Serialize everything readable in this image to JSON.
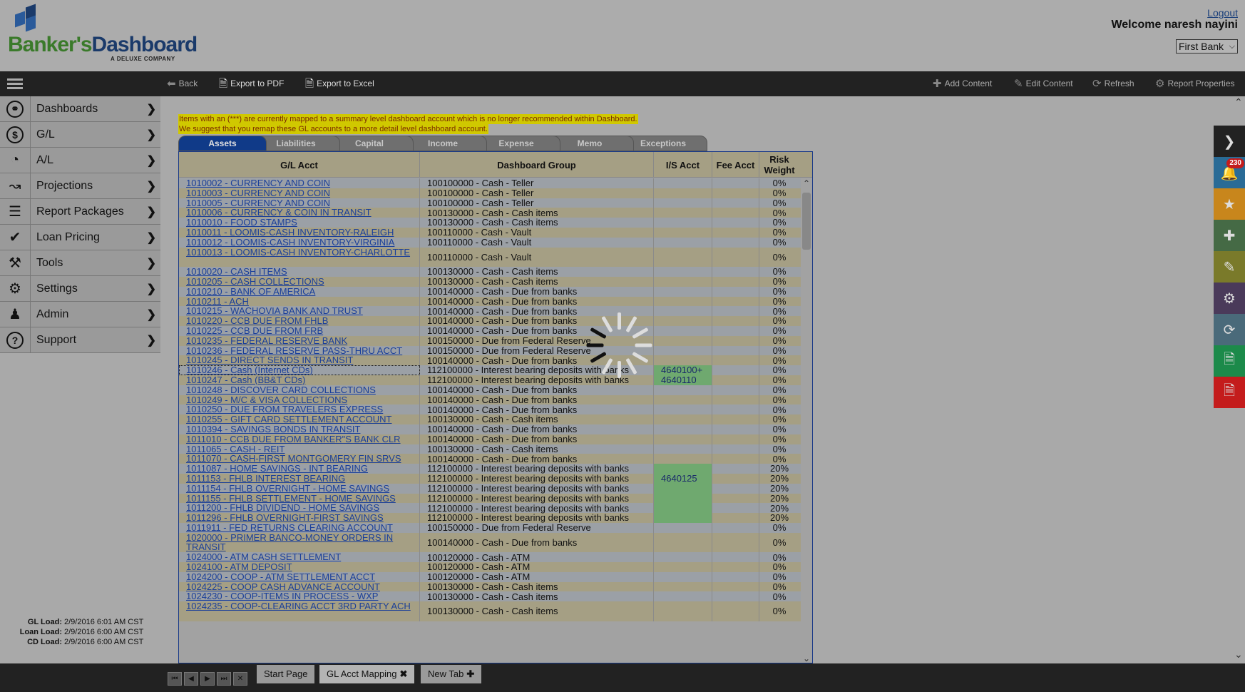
{
  "header": {
    "brand_part1": "Banker's",
    "brand_part2": "Dashboard",
    "brand_tagline": "A DELUXE COMPANY",
    "logout": "Logout",
    "welcome": "Welcome  naresh nayini",
    "bank": "First Bank"
  },
  "toolbar": {
    "back": "Back",
    "export_pdf": "Export to PDF",
    "export_excel": "Export to Excel",
    "add_content": "Add Content",
    "edit_content": "Edit Content",
    "refresh": "Refresh",
    "report_properties": "Report Properties"
  },
  "sidebar": {
    "items": [
      {
        "label": "Dashboards",
        "icon": "dashboard-icon"
      },
      {
        "label": "G/L",
        "icon": "dollar-icon"
      },
      {
        "label": "A/L",
        "icon": "pie-chart-icon"
      },
      {
        "label": "Projections",
        "icon": "line-chart-icon"
      },
      {
        "label": "Report Packages",
        "icon": "layers-icon"
      },
      {
        "label": "Loan Pricing",
        "icon": "check-icon"
      },
      {
        "label": "Tools",
        "icon": "hammer-icon"
      },
      {
        "label": "Settings",
        "icon": "gear-icon"
      },
      {
        "label": "Admin",
        "icon": "user-icon"
      },
      {
        "label": "Support",
        "icon": "help-icon"
      }
    ]
  },
  "loads": [
    {
      "label": "GL Load:",
      "value": "2/9/2016 6:01 AM CST"
    },
    {
      "label": "Loan Load:",
      "value": "2/9/2016 6:00 AM CST"
    },
    {
      "label": "CD Load:",
      "value": "2/9/2016 6:00 AM CST"
    }
  ],
  "notice": {
    "line1": "Items with an (***) are currently mapped to a summary level dashboard account which is no longer recommended within Dashboard.",
    "line2": "We suggest that you remap these GL accounts to a more detail level dashboard account."
  },
  "tabs": [
    "Assets",
    "Liabilities",
    "Capital",
    "Income",
    "Expense",
    "Memo",
    "Exceptions"
  ],
  "active_tab": "Assets",
  "columns": [
    "G/L Acct",
    "Dashboard Group",
    "I/S Acct",
    "Fee Acct",
    "Risk Weight"
  ],
  "rows": [
    {
      "gl": "1010002 - CURRENCY AND COIN",
      "group": "100100000 - Cash - Teller",
      "is": "",
      "fee": "",
      "risk": "0%"
    },
    {
      "gl": "1010003 - CURRENCY AND COIN",
      "group": "100100000 - Cash - Teller",
      "is": "",
      "fee": "",
      "risk": "0%"
    },
    {
      "gl": "1010005 - CURRENCY AND COIN",
      "group": "100100000 - Cash - Teller",
      "is": "",
      "fee": "",
      "risk": "0%"
    },
    {
      "gl": "1010006 - CURRENCY & COIN IN TRANSIT",
      "group": "100130000 - Cash - Cash items",
      "is": "",
      "fee": "",
      "risk": "0%"
    },
    {
      "gl": "1010010 - FOOD STAMPS",
      "group": "100130000 - Cash - Cash items",
      "is": "",
      "fee": "",
      "risk": "0%"
    },
    {
      "gl": "1010011 - LOOMIS-CASH INVENTORY-RALEIGH",
      "group": "100110000 - Cash - Vault",
      "is": "",
      "fee": "",
      "risk": "0%"
    },
    {
      "gl": "1010012 - LOOMIS-CASH INVENTORY-VIRGINIA",
      "group": "100110000 - Cash - Vault",
      "is": "",
      "fee": "",
      "risk": "0%"
    },
    {
      "gl": "1010013 - LOOMIS-CASH INVENTORY-CHARLOTTE",
      "group": "100110000 - Cash - Vault",
      "is": "",
      "fee": "",
      "risk": "0%",
      "tall": true
    },
    {
      "gl": "1010020 - CASH ITEMS",
      "group": "100130000 - Cash - Cash items",
      "is": "",
      "fee": "",
      "risk": "0%"
    },
    {
      "gl": "1010205 - CASH COLLECTIONS",
      "group": "100130000 - Cash - Cash items",
      "is": "",
      "fee": "",
      "risk": "0%"
    },
    {
      "gl": "1010210 - BANK OF AMERICA",
      "group": "100140000 - Cash - Due from banks",
      "is": "",
      "fee": "",
      "risk": "0%"
    },
    {
      "gl": "1010211 - ACH",
      "group": "100140000 - Cash - Due from banks",
      "is": "",
      "fee": "",
      "risk": "0%"
    },
    {
      "gl": "1010215 - WACHOVIA BANK AND TRUST",
      "group": "100140000 - Cash - Due from banks",
      "is": "",
      "fee": "",
      "risk": "0%"
    },
    {
      "gl": "1010220 - CCB DUE FROM FHLB",
      "group": "100140000 - Cash - Due from banks",
      "is": "",
      "fee": "",
      "risk": "0%"
    },
    {
      "gl": "1010225 - CCB DUE FROM FRB",
      "group": "100140000 - Cash - Due from banks",
      "is": "",
      "fee": "",
      "risk": "0%"
    },
    {
      "gl": "1010235 - FEDERAL RESERVE BANK",
      "group": "100150000 - Due from Federal Reserve",
      "is": "",
      "fee": "",
      "risk": "0%"
    },
    {
      "gl": "1010236 - FEDERAL RESERVE PASS-THRU ACCT",
      "group": "100150000 - Due from Federal Reserve",
      "is": "",
      "fee": "",
      "risk": "0%"
    },
    {
      "gl": "1010245 - DIRECT SENDS IN TRANSIT",
      "group": "100140000 - Cash - Due from banks",
      "is": "",
      "fee": "",
      "risk": "0%"
    },
    {
      "gl": "1010246 - Cash (Internet CDs)",
      "group": "112100000 - Interest bearing deposits with banks",
      "is": "4640100+",
      "fee": "",
      "risk": "0%",
      "green": true,
      "focused": true
    },
    {
      "gl": "1010247 - Cash (BB&T CDs)",
      "group": "112100000 - Interest bearing deposits with banks",
      "is": "4640110",
      "fee": "",
      "risk": "0%",
      "green": true
    },
    {
      "gl": "1010248 - DISCOVER CARD COLLECTIONS",
      "group": "100140000 - Cash - Due from banks",
      "is": "",
      "fee": "",
      "risk": "0%"
    },
    {
      "gl": "1010249 - M/C & VISA COLLECTIONS",
      "group": "100140000 - Cash - Due from banks",
      "is": "",
      "fee": "",
      "risk": "0%"
    },
    {
      "gl": "1010250 - DUE FROM TRAVELERS EXPRESS",
      "group": "100140000 - Cash - Due from banks",
      "is": "",
      "fee": "",
      "risk": "0%"
    },
    {
      "gl": "1010255 - GIFT CARD SETTLEMENT ACCOUNT",
      "group": "100130000 - Cash - Cash items",
      "is": "",
      "fee": "",
      "risk": "0%"
    },
    {
      "gl": "1010394 - SAVINGS BONDS IN TRANSIT",
      "group": "100140000 - Cash - Due from banks",
      "is": "",
      "fee": "",
      "risk": "0%"
    },
    {
      "gl": "1011010 - CCB DUE FROM BANKER\"S BANK CLR",
      "group": "100140000 - Cash - Due from banks",
      "is": "",
      "fee": "",
      "risk": "0%"
    },
    {
      "gl": "1011065 - CASH - REIT",
      "group": "100130000 - Cash - Cash items",
      "is": "",
      "fee": "",
      "risk": "0%"
    },
    {
      "gl": "1011070 - CASH-FIRST MONTGOMERY FIN SRVS",
      "group": "100140000 - Cash - Due from banks",
      "is": "",
      "fee": "",
      "risk": "0%"
    },
    {
      "gl": "1011087 - HOME SAVINGS - INT BEARING",
      "group": "112100000 - Interest bearing deposits with banks",
      "is": "",
      "fee": "",
      "risk": "20%",
      "green": true
    },
    {
      "gl": "1011153 - FHLB INTEREST BEARING",
      "group": "112100000 - Interest bearing deposits with banks",
      "is": "4640125",
      "fee": "",
      "risk": "20%",
      "green": true
    },
    {
      "gl": "1011154 - FHLB OVERNIGHT - HOME SAVINGS",
      "group": "112100000 - Interest bearing deposits with banks",
      "is": "",
      "fee": "",
      "risk": "20%",
      "green": true
    },
    {
      "gl": "1011155 - FHLB SETTLEMENT - HOME SAVINGS",
      "group": "112100000 - Interest bearing deposits with banks",
      "is": "",
      "fee": "",
      "risk": "20%",
      "green": true
    },
    {
      "gl": "1011200 - FHLB DIVIDEND - HOME SAVINGS",
      "group": "112100000 - Interest bearing deposits with banks",
      "is": "",
      "fee": "",
      "risk": "20%",
      "green": true
    },
    {
      "gl": "1011296 - FHLB OVERNIGHT-FIRST SAVINGS",
      "group": "112100000 - Interest bearing deposits with banks",
      "is": "",
      "fee": "",
      "risk": "20%",
      "green": true
    },
    {
      "gl": "1011911 - FED RETURNS CLEARING ACCOUNT",
      "group": "100150000 - Due from Federal Reserve",
      "is": "",
      "fee": "",
      "risk": "0%"
    },
    {
      "gl": "1020000 - PRIMER BANCO-MONEY ORDERS IN TRANSIT",
      "group": "100140000 - Cash - Due from banks",
      "is": "",
      "fee": "",
      "risk": "0%",
      "tall": true
    },
    {
      "gl": "1024000 - ATM CASH SETTLEMENT",
      "group": "100120000 - Cash - ATM",
      "is": "",
      "fee": "",
      "risk": "0%"
    },
    {
      "gl": "1024100 - ATM DEPOSIT",
      "group": "100120000 - Cash - ATM",
      "is": "",
      "fee": "",
      "risk": "0%"
    },
    {
      "gl": "1024200 - COOP - ATM SETTLEMENT ACCT",
      "group": "100120000 - Cash - ATM",
      "is": "",
      "fee": "",
      "risk": "0%"
    },
    {
      "gl": "1024225 - COOP CASH ADVANCE ACCOUNT",
      "group": "100130000 - Cash - Cash items",
      "is": "",
      "fee": "",
      "risk": "0%"
    },
    {
      "gl": "1024230 - COOP-ITEMS IN PROCESS - WXP",
      "group": "100130000 - Cash - Cash items",
      "is": "",
      "fee": "",
      "risk": "0%"
    },
    {
      "gl": "1024235 - COOP-CLEARING ACCT 3RD PARTY ACH",
      "group": "100130000 - Cash - Cash items",
      "is": "",
      "fee": "",
      "risk": "0%",
      "tall": true
    }
  ],
  "right_rail": {
    "badge": "230",
    "buttons": [
      {
        "icon": "chevron-right-icon",
        "color": "#222222"
      },
      {
        "icon": "bell-icon",
        "color": "#2a6b96"
      },
      {
        "icon": "star-icon",
        "color": "#c8861c"
      },
      {
        "icon": "plus-icon",
        "color": "#456a45"
      },
      {
        "icon": "pencil-icon",
        "color": "#7a7a2a"
      },
      {
        "icon": "gear-icon",
        "color": "#4a3a5a"
      },
      {
        "icon": "refresh-icon",
        "color": "#4a6a7a"
      },
      {
        "icon": "excel-icon",
        "color": "#1c8a4a"
      },
      {
        "icon": "pdf-icon",
        "color": "#c41c1c"
      }
    ]
  },
  "bottom_tabs": {
    "start_page": "Start Page",
    "gl_acct_mapping": "GL Acct Mapping",
    "new_tab": "New Tab"
  }
}
